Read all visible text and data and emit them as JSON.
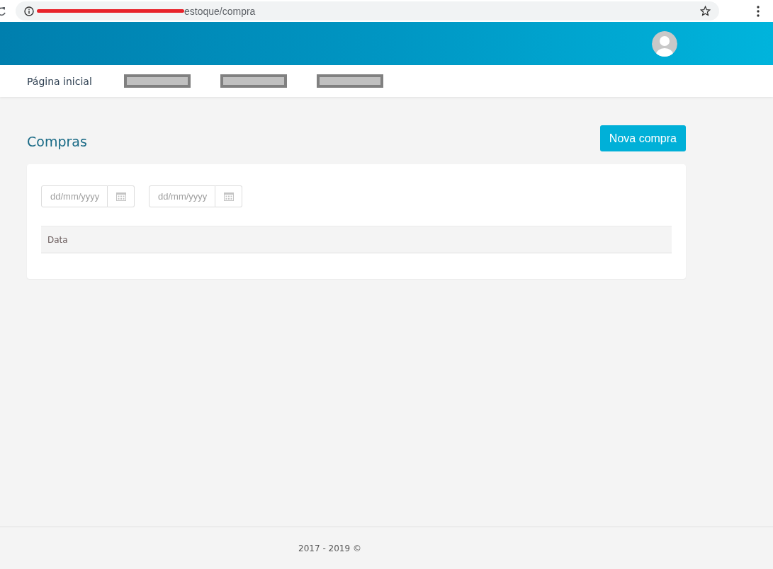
{
  "browser": {
    "url": "estoque/compra",
    "url_redacted": true
  },
  "nav": {
    "items": [
      {
        "kind": "link",
        "label": "Página inicial"
      },
      {
        "kind": "redacted"
      },
      {
        "kind": "redacted"
      },
      {
        "kind": "redacted"
      }
    ]
  },
  "page": {
    "title": "Compras",
    "action": "Nova compra"
  },
  "filters": [
    {
      "placeholder": "dd/mm/yyyy"
    },
    {
      "placeholder": "dd/mm/yyyy"
    }
  ],
  "table": {
    "columns": [
      "Data"
    ]
  },
  "footer": "2017 - 2019 ©"
}
